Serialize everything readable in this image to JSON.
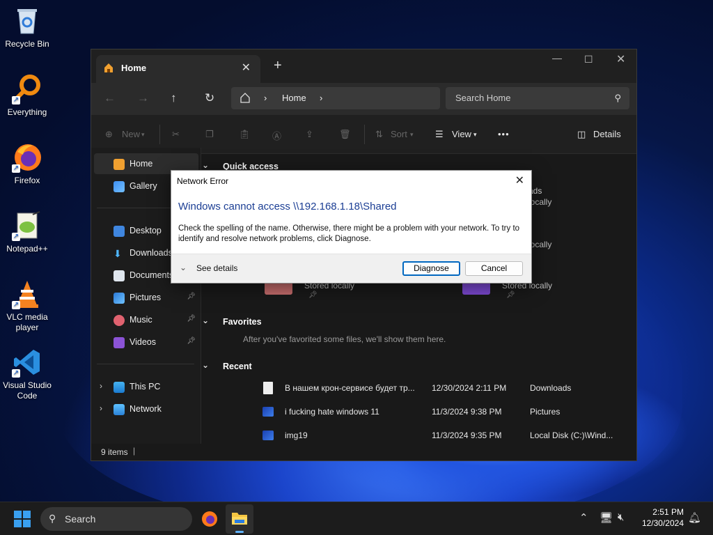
{
  "desktop": {
    "icons": [
      {
        "label": "Recycle Bin"
      },
      {
        "label": "Everything"
      },
      {
        "label": "Firefox"
      },
      {
        "label": "Notepad++"
      },
      {
        "label": "VLC media player"
      },
      {
        "label": "Visual Studio Code"
      }
    ]
  },
  "explorer": {
    "tab_title": "Home",
    "tab_close": "✕",
    "new_tab": "+",
    "address": {
      "home": "Home",
      "sep1": "›",
      "sep2": "›"
    },
    "search_placeholder": "Search Home",
    "toolbar": {
      "new": "New",
      "sort": "Sort",
      "view": "View",
      "more": "•••",
      "details": "Details"
    },
    "nav": [
      {
        "label": "Home"
      },
      {
        "label": "Gallery"
      },
      {
        "label": "Desktop"
      },
      {
        "label": "Downloads"
      },
      {
        "label": "Documents"
      },
      {
        "label": "Pictures"
      },
      {
        "label": "Music"
      },
      {
        "label": "Videos"
      },
      {
        "label": "This PC"
      },
      {
        "label": "Network"
      }
    ],
    "quick_access": {
      "header": "Quick access",
      "frag_ads": "ads",
      "frag_locally1": "locally",
      "frag_locally2": "locally",
      "stored1": "Stored locally",
      "stored2": "Stored locally"
    },
    "favorites": {
      "header": "Favorites",
      "empty": "After you've favorited some files, we'll show them here."
    },
    "recent": {
      "header": "Recent",
      "rows": [
        {
          "name": "В нашем крон-сервисе будет тр...",
          "date": "12/30/2024 2:11 PM",
          "location": "Downloads"
        },
        {
          "name": "i fucking hate windows 11",
          "date": "11/3/2024 9:38 PM",
          "location": "Pictures"
        },
        {
          "name": "img19",
          "date": "11/3/2024 9:35 PM",
          "location": "Local Disk (C:)\\Wind..."
        }
      ]
    },
    "status": "9 items"
  },
  "dialog": {
    "title": "Network Error",
    "main": "Windows cannot access \\\\192.168.1.18\\Shared",
    "body": "Check the spelling of the name. Otherwise, there might be a problem with your network. To try to identify and resolve network problems, click Diagnose.",
    "see_details": "See details",
    "diagnose": "Diagnose",
    "cancel": "Cancel"
  },
  "taskbar": {
    "search": "Search",
    "time": "2:51 PM",
    "date": "12/30/2024"
  }
}
